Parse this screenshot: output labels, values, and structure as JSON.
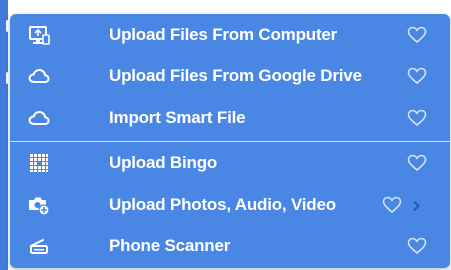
{
  "menu": {
    "items": [
      {
        "label": "Upload Files From Computer",
        "icon": "computer-upload-icon",
        "favorite_icon": "heart-outline-icon"
      },
      {
        "label": "Upload Files From Google Drive",
        "icon": "cloud-icon",
        "favorite_icon": "heart-outline-icon"
      },
      {
        "label": "Import Smart File",
        "icon": "cloud-icon",
        "favorite_icon": "heart-outline-icon"
      },
      {
        "label": "Upload Bingo",
        "icon": "bingo-grid-icon",
        "favorite_icon": "heart-outline-icon"
      },
      {
        "label": "Upload Photos, Audio, Video",
        "icon": "camera-add-icon",
        "favorite_icon": "heart-outline-icon",
        "has_submenu": true
      },
      {
        "label": "Phone Scanner",
        "icon": "scanner-icon",
        "favorite_icon": "heart-outline-icon"
      }
    ]
  },
  "colors": {
    "menu_background": "#4a87e4",
    "text": "#ffffff",
    "heart": "#d6e4fb",
    "divider": "#cfe0fb",
    "chevron": "#2d5aa8"
  }
}
